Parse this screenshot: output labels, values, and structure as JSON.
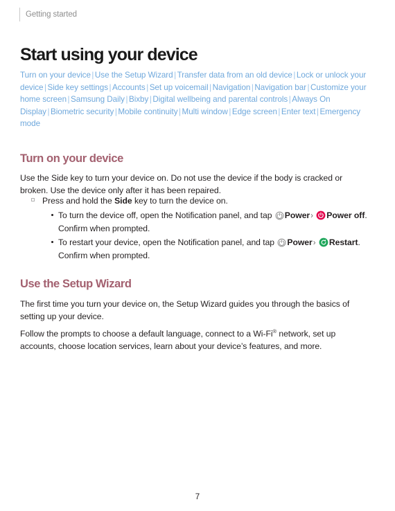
{
  "running_header": {
    "text": "Getting started"
  },
  "page_title": "Start using your device",
  "colors": {
    "link": "#6FA8DC",
    "heading": "#A3606F",
    "body": "#231F20",
    "power_off_icon": "#E4004B",
    "restart_icon": "#1DA65A",
    "header_text": "#8E8E8E"
  },
  "link_list": {
    "separator": "|",
    "links": [
      "Turn on your device",
      "Use the Setup Wizard",
      "Transfer data from an old device",
      "Lock or unlock your device",
      "Side key settings",
      "Accounts",
      "Set up voicemail",
      "Navigation",
      "Navigation bar",
      "Customize your home screen",
      "Samsung Daily",
      "Bixby",
      "Digital wellbeing and parental controls",
      "Always On Display",
      "Biometric security",
      "Mobile continuity",
      "Multi window",
      "Edge screen",
      "Enter text",
      "Emergency mode"
    ]
  },
  "sections": {
    "turn_on": {
      "heading": "Turn on your device",
      "paragraph": "Use the Side key to turn your device on. Do not use the device if the body is cracked or broken. Use the device only after it has been repaired.",
      "bullet": {
        "text_before_bold": "Press and hold the ",
        "bold_word": "Side",
        "text_after_bold": " key to turn the device on."
      },
      "sub_bullets": [
        {
          "lead_text": "To turn the device off, open the Notification panel, and tap",
          "power_icon_name": "power-outline-icon",
          "power_label": "Power",
          "chevron": "›",
          "action_icon_name": "power-off-icon",
          "action_label": "Power off",
          "trailing_text": ". Confirm when prompted."
        },
        {
          "lead_text": "To restart your device, open the Notification panel, and tap",
          "power_icon_name": "power-outline-icon",
          "power_label": "Power",
          "chevron": "›",
          "action_icon_name": "restart-icon",
          "action_label": "Restart",
          "trailing_text": ". Confirm when prompted."
        }
      ]
    },
    "setup_wizard": {
      "heading": "Use the Setup Wizard",
      "paragraph_1": "The first time you turn your device on, the Setup Wizard guides you through the basics of setting up your device.",
      "paragraph_2_part_1": "Follow the prompts to choose a default language, connect to a Wi-Fi",
      "paragraph_2_reg": "®",
      "paragraph_2_part_2": " network, set up accounts, choose location services, learn about your device’s features, and more."
    }
  },
  "footer": {
    "page_number": "7"
  }
}
